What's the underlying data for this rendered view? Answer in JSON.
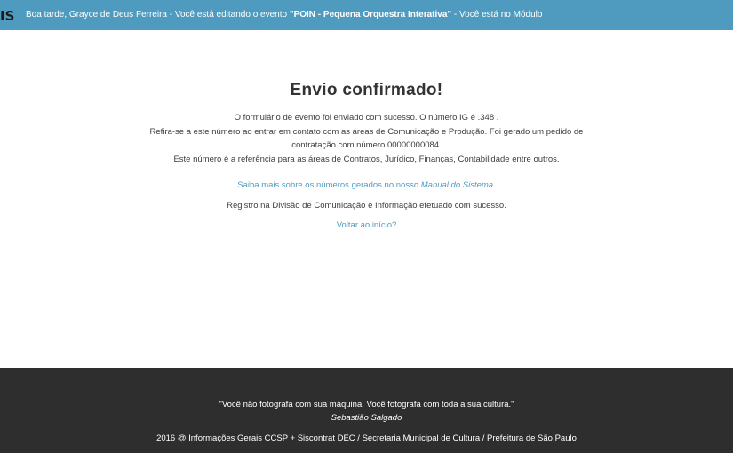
{
  "topbar": {
    "logo": "IS",
    "greeting_prefix": "Boa tarde, Grayce de Deus Ferreira - Você está editando o evento ",
    "event_name": "\"POIN - Pequena Orquestra Interativa\"",
    "greeting_suffix": " - Você está no Módulo"
  },
  "main": {
    "title": "Envio confirmado!",
    "lines": [
      "O formulário de evento foi enviado com sucesso. O número IG é .348 .",
      "Refira-se a este número ao entrar em contato com as áreas de Comunicação e Produção. Foi gerado um pedido de",
      "contratação com número 00000000084.",
      "Este número é a referência para as áreas de Contratos, Jurídico, Finanças, Contabilidade entre outros."
    ],
    "help_prefix": "Saiba mais sobre os números gerados no nosso ",
    "help_link": "Manual do Sistema",
    "help_suffix": ".",
    "registro": "Registro na Divisão de Comunicação e Informação efetuado com sucesso.",
    "back_link": "Voltar ao início?"
  },
  "footer": {
    "quote": "\"Você não fotografa com sua máquina. Você fotografa com toda a sua cultura.\"",
    "author": "Sebastião Salgado",
    "copyright": "2016 @ Informações Gerais CCSP + Siscontrat DEC / Secretaria Municipal de Cultura / Prefeitura de São Paulo"
  },
  "colors": {
    "topbar": "#4f9bbf",
    "link": "#4f9bbf",
    "footer": "#2e2e2e"
  }
}
